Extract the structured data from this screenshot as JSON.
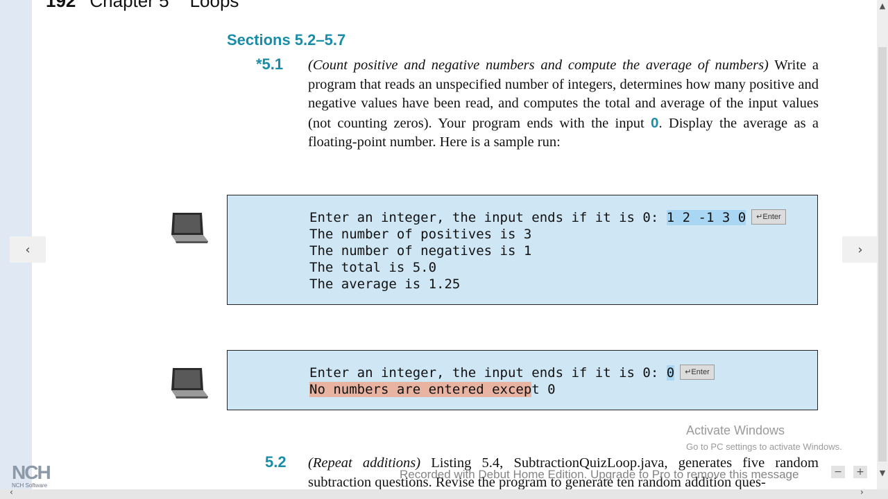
{
  "header": {
    "page_number": "192",
    "chapter": "Chapter 5",
    "title": "Loops"
  },
  "section_heading": "Sections 5.2–5.7",
  "exercise1": {
    "number": "*5.1",
    "title": "(Count positive and negative numbers and compute the average of numbers)",
    "body_part1": " Write a program that reads an unspecified number of integers, determines how many positive and negative values have been read, and computes the total and average of the input values (not counting zeros). Your program ends with the input ",
    "highlight": "0",
    "body_part2": ". Display the average as a floating-point number. Here is a sample run:"
  },
  "console1": {
    "prompt": "Enter an integer, the input ends if it is 0: ",
    "input": "1 2 -1 3 0",
    "enter_label": "↵Enter",
    "lines": [
      "The number of positives is 3",
      "The number of negatives is 1",
      "The total is 5.0",
      "The average is 1.25"
    ]
  },
  "console2": {
    "prompt": "Enter an integer, the input ends if it is 0: ",
    "input": "0",
    "enter_label": "↵Enter",
    "msg_highlighted": "No numbers are entered excep",
    "msg_rest": "t 0"
  },
  "exercise2": {
    "number": "5.2",
    "title": "(Repeat additions)",
    "body": " Listing 5.4, SubtractionQuizLoop.java, generates five random subtraction questions. Revise the program to generate ten random addition ques-"
  },
  "overlay": {
    "activate_title": "Activate Windows",
    "activate_sub": "Go to PC settings to activate Windows.",
    "watermark": "Recorded with Debut Home Edition. Upgrade to Pro to remove this message",
    "nch_logo": "NCH",
    "nch_sub": "NCH Software"
  },
  "icons": {
    "prev": "chevron-left-icon",
    "next": "chevron-right-icon",
    "laptop": "laptop-icon"
  },
  "glyphs": {
    "prev": "‹",
    "next": "›",
    "scroll_up": "▲",
    "scroll_down": "▼",
    "bottom_left": "‹",
    "bottom_right": "›",
    "minus": "−",
    "plus": "+"
  },
  "colors": {
    "accent": "#1a8ca8",
    "console_bg": "#cfe6f5",
    "input_highlight": "#a9d6f2",
    "error_highlight": "#e9b3a2"
  }
}
